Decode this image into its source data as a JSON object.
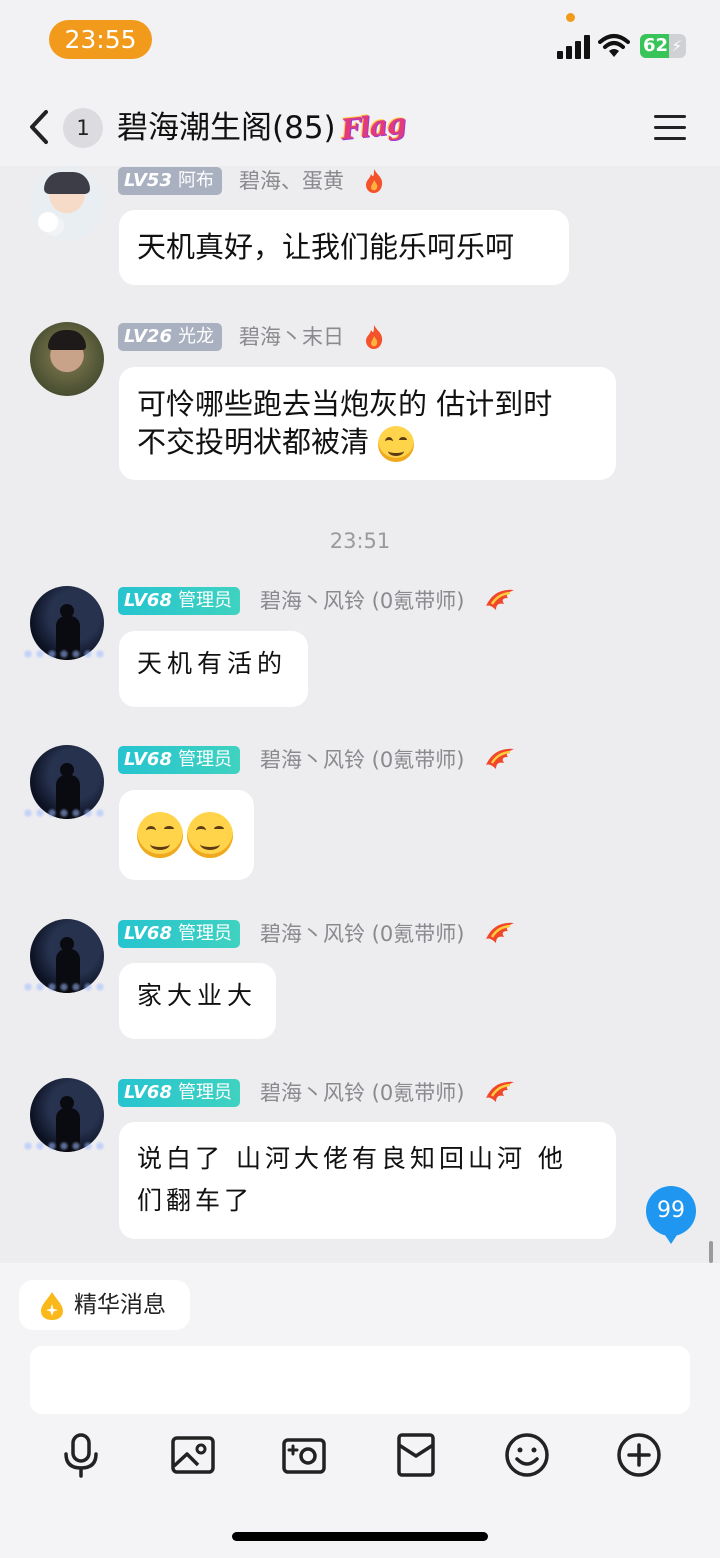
{
  "status_bar": {
    "time": "23:55",
    "battery": "62",
    "battery_level": 0.62
  },
  "header": {
    "unread": "1",
    "title": "碧海潮生阁(85)",
    "flag": "Flag"
  },
  "messages": [
    {
      "level": "LV53",
      "role": "阿布",
      "sender": "碧海、蛋黄",
      "text": "天机真好，让我们能乐呵乐呵"
    },
    {
      "level": "LV26",
      "role": "光龙",
      "sender": "碧海丶末日",
      "text_line1": "可怜哪些跑去当炮灰的  估计到时",
      "text_line2": "不交投明状都被清"
    },
    {
      "level": "LV68",
      "role": "管理员",
      "sender": "碧海丶风铃 (0氪带师)",
      "text": "天机有活的"
    },
    {
      "level": "LV68",
      "role": "管理员",
      "sender": "碧海丶风铃 (0氪带师)"
    },
    {
      "level": "LV68",
      "role": "管理员",
      "sender": "碧海丶风铃 (0氪带师)",
      "text": "家大业大"
    },
    {
      "level": "LV68",
      "role": "管理员",
      "sender": "碧海丶风铃 (0氪带师)",
      "text_line1": "说白了 山河大佬有良知回山河 他",
      "text_line2": "们翻车了"
    }
  ],
  "timestamp": "23:51",
  "new_message_count": "99",
  "essence": {
    "label": "精华消息"
  },
  "input": {
    "value": ""
  },
  "toolbar_icons": [
    "microphone-icon",
    "image-icon",
    "camera-icon",
    "red-packet-icon",
    "emoji-icon",
    "plus-icon"
  ]
}
